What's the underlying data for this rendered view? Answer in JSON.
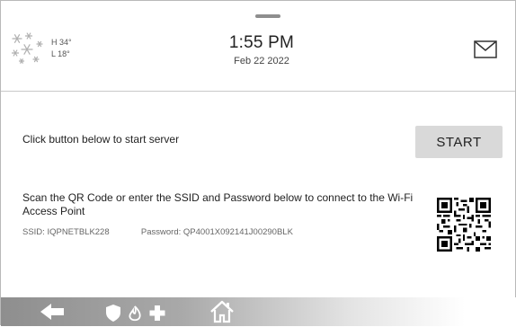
{
  "status_bar": {
    "weather": {
      "icon": "snowflake-icon",
      "high": "H 34°",
      "low": "L 18°"
    },
    "time": "1:55 PM",
    "date": "Feb 22 2022",
    "messages_icon": "envelope-icon"
  },
  "server": {
    "instruction": "Click button below to start server",
    "start_label": "START"
  },
  "wifi": {
    "instruction": "Scan the QR Code or enter the SSID and Password below to connect to the Wi-Fi Access Point",
    "ssid_label": "SSID:",
    "ssid_value": "IQPNETBLK228",
    "password_label": "Password:",
    "password_value": "QP4001X092141J00290BLK",
    "qr_icon": "qr-code-icon"
  },
  "nav_bar": {
    "icons": [
      "back-arrow-icon",
      "security-icon",
      "home-icon"
    ],
    "gradient": [
      "#8e8e8e",
      "#ffffff"
    ]
  },
  "colors": {
    "button_bg": "#d9d9d9",
    "text": "#222222",
    "muted": "#666666"
  }
}
